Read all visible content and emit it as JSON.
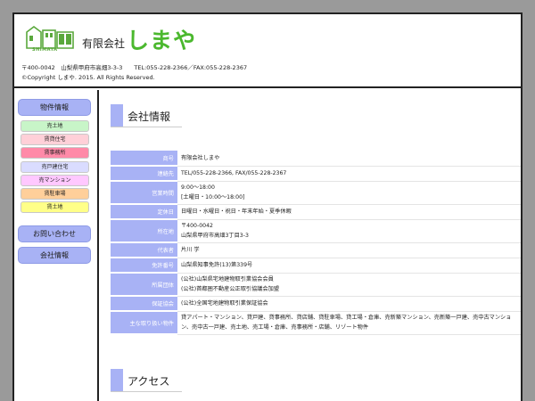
{
  "header": {
    "logo_text": "SHIMAYA",
    "company_prefix": "有限会社",
    "company_name": "しまや",
    "address_line": "〒400-0042　山梨県甲府市高畑3-3-3　　TEL:055-228-2366／FAX:055-228-2367",
    "copyright": "©Copyright しまや. 2015. All Rights Reserved."
  },
  "sidebar": {
    "property_info_label": "物件情報",
    "items": [
      {
        "label": "売土地",
        "color": "#c8f5c8"
      },
      {
        "label": "賃貸住宅",
        "color": "#ffd0d8"
      },
      {
        "label": "賃事務所",
        "color": "#ff8aa8"
      },
      {
        "label": "売戸建住宅",
        "color": "#dadcff"
      },
      {
        "label": "売マンション",
        "color": "#ffc8ff"
      },
      {
        "label": "賃駐車場",
        "color": "#ffcf9a"
      },
      {
        "label": "賃土地",
        "color": "#ffff88"
      }
    ],
    "contact_label": "お問い合わせ",
    "company_info_label": "会社情報"
  },
  "main": {
    "company_section_title": "会社情報",
    "access_section_title": "アクセス",
    "info_rows": [
      {
        "label": "商号",
        "value": "有限会社しまや"
      },
      {
        "label": "連絡先",
        "value": "TEL/055-228-2366, FAX/055-228-2367"
      },
      {
        "label": "営業時間",
        "value": "9:00～18:00\n[土曜日・10:00～18:00]"
      },
      {
        "label": "定休日",
        "value": "日曜日・水曜日・祝日・年末年始・夏季休暇"
      },
      {
        "label": "所在地",
        "value": "〒400-0042\n山梨県甲府市高畑3丁目3-3"
      },
      {
        "label": "代表者",
        "value": "片川 学"
      },
      {
        "label": "免許番号",
        "value": "山梨県知事免許(13)第339号"
      },
      {
        "label": "所属団体",
        "value": "(公社)山梨県宅地建物取引業協会会員\n(公社)首都圏不動産公正取引協議会加盟"
      },
      {
        "label": "保証協会",
        "value": "(公社)全国宅地建物取引業保証協会"
      },
      {
        "label": "主な取り扱い物件",
        "value": "貸アパート・マンション、貸戸建、貸事務所、貸店舗、貸駐車場、貸工場・倉庫、売新築マンション、売新築一戸建、売中古マンション、売中古一戸建、売土地、売工場・倉庫、売事務所・店舗、リゾート物件"
      }
    ]
  }
}
